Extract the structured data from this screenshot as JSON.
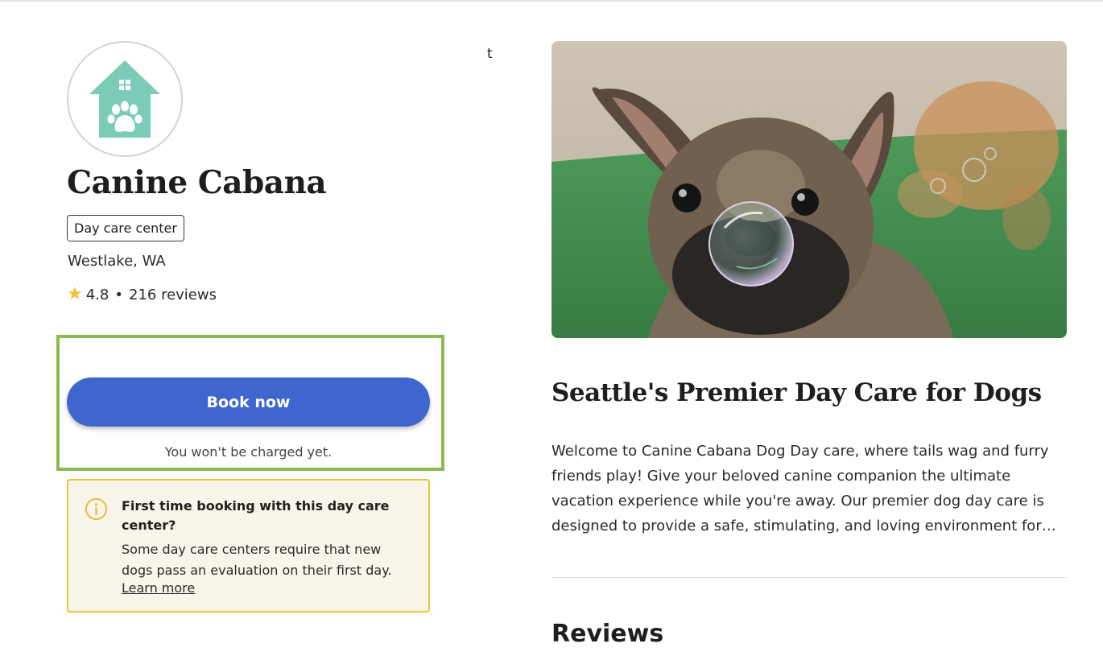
{
  "business": {
    "name": "Canine Cabana",
    "type_badge": "Day care center",
    "location": "Westlake, WA",
    "rating": "4.8",
    "separator": "•",
    "reviews_count": "216 reviews",
    "logo_icon": "house-paw-icon",
    "logo_color": "#7ccbb9"
  },
  "booking": {
    "button_label": "Book now",
    "note": "You won't be charged yet.",
    "button_color": "#3f66cf",
    "highlight_color": "#8bbb4f"
  },
  "info_notice": {
    "icon": "info-icon",
    "title": "First time booking with this day care center?",
    "body": "Some day care centers require that new dogs pass an evaluation on their first day.",
    "link_label": "Learn more",
    "border_color": "#f0c040",
    "background": "#faf5ea"
  },
  "stray_text": "t",
  "main": {
    "hero_image": "french-bulldog-bubble-photo",
    "heading": "Seattle's Premier Day Care for Dogs",
    "description": "Welcome to Canine Cabana Dog Day care, where tails wag and furry friends play! Give your beloved canine companion the ultimate vacation experience while you're away. Our premier dog day care is designed to provide a safe, stimulating, and loving environment for…",
    "reviews_heading": "Reviews"
  }
}
